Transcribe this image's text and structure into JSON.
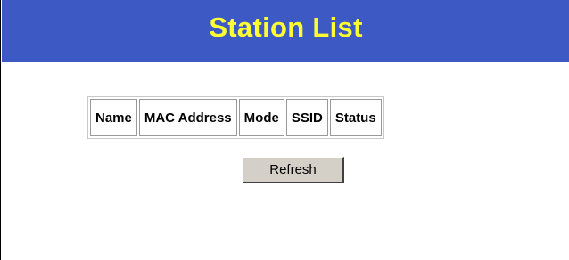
{
  "header": {
    "title": "Station List"
  },
  "table": {
    "columns": [
      "Name",
      "MAC Address",
      "Mode",
      "SSID",
      "Status"
    ],
    "rows": []
  },
  "actions": {
    "refresh_label": "Refresh"
  },
  "colors": {
    "title_background": "#3c59c4",
    "title_text": "#ffff33"
  }
}
